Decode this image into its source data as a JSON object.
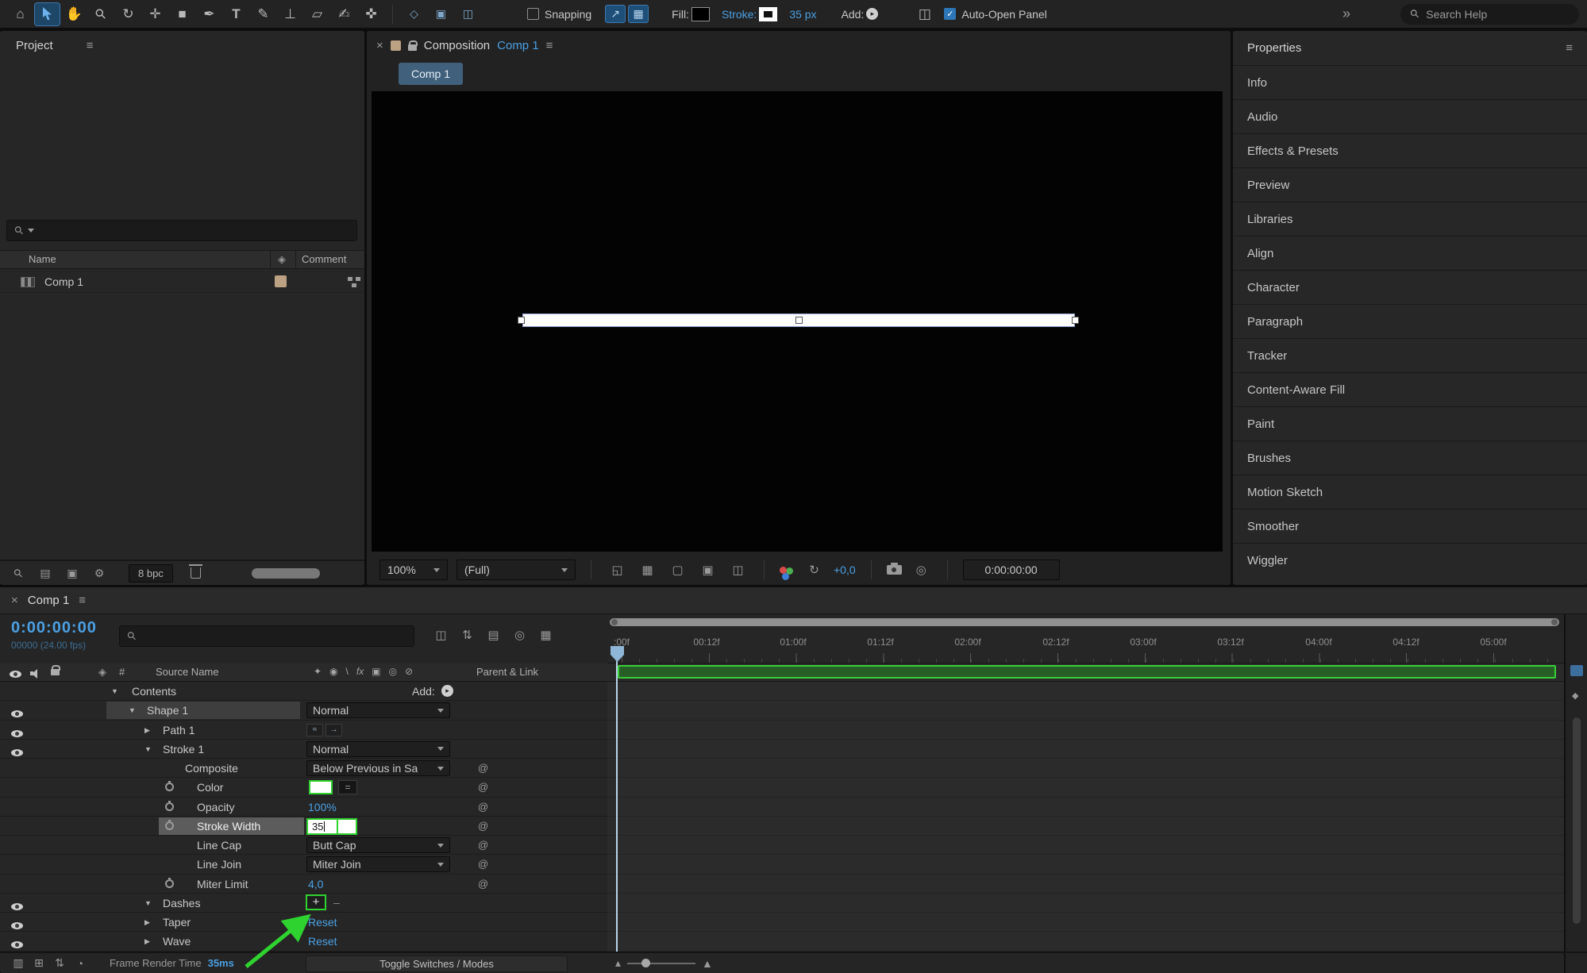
{
  "accent": {
    "blue": "#4aa0e4",
    "green": "#2fd32f"
  },
  "icons": {
    "home": "⌂",
    "hand": "✋",
    "zoom": "⚲",
    "rotate": "↻",
    "pan_behind": "✛",
    "shape": "■",
    "pen": "✒",
    "type": "T",
    "brush": "✎",
    "stamp": "⊥",
    "eraser": "▱",
    "roto_brush": "✍",
    "puppet_pin": "✜",
    "axis_local": "◇",
    "axis_world": "▣",
    "axis_view": "◫",
    "snap_edge": "↗",
    "snap_grid": "▦",
    "workspace": "◫",
    "more": "»",
    "menu": "≡",
    "close": "×",
    "twirl_open": "▼",
    "twirl_closed": "▶",
    "plus": "+",
    "dash": "‒",
    "pickwhip": "@",
    "check": "✓",
    "play": "▸",
    "comp_flow": "◫",
    "draft": "⇅",
    "shy": "▤",
    "blend": "◎",
    "graph": "▦",
    "sw_shy": "✦",
    "sw_collapse": "◉",
    "sw_draft": "\\",
    "sw_fx": "fx",
    "sw_blend": "▣",
    "sw_mblur": "◎",
    "sw_3d": "⊘",
    "label_tag": "◈",
    "eq": "=",
    "diamond": "◆",
    "find": "⚲",
    "folder": "▤",
    "newcomp": "▣",
    "gear": "⚙",
    "mini_a": "≈",
    "mini_b": "→",
    "view_a": "◱",
    "view_b": "▦",
    "view_c": "▢",
    "view_d": "▣",
    "view_e": "◫",
    "refresh": "↻",
    "tl_a": "▥",
    "tl_b": "⊞",
    "tl_c": "⇅",
    "tl_d": "◔",
    "zoom_out": "▴",
    "zoom_in": "▲"
  },
  "toolbar": {
    "snapping_label": "Snapping",
    "fill_label": "Fill:",
    "stroke_label": "Stroke:",
    "stroke_width_label": "35 px",
    "add_label": "Add:",
    "auto_open_label": "Auto-Open Panel",
    "search_placeholder": "Search Help"
  },
  "project": {
    "title": "Project",
    "col_name": "Name",
    "col_comment": "Comment",
    "item_name": "Comp 1",
    "bpc_label": "8 bpc"
  },
  "composition": {
    "tab_label": "Composition",
    "tab_comp": "Comp 1",
    "subtab": "Comp 1",
    "zoom": "100%",
    "resolution": "(Full)",
    "exposure": "+0,0",
    "timecode": "0:00:00:00"
  },
  "properties": {
    "title": "Properties",
    "items": [
      "Info",
      "Audio",
      "Effects & Presets",
      "Preview",
      "Libraries",
      "Align",
      "Character",
      "Paragraph",
      "Tracker",
      "Content-Aware Fill",
      "Paint",
      "Brushes",
      "Motion Sketch",
      "Smoother",
      "Wiggler"
    ]
  },
  "timeline": {
    "tab": "Comp 1",
    "current_time": "0:00:00:00",
    "frame_info": "00000 (24.00 fps)",
    "col_hash": "#",
    "col_source": "Source Name",
    "col_parent": "Parent & Link",
    "add_label": "Add:",
    "ruler": [
      ":00f",
      "00:12f",
      "01:00f",
      "01:12f",
      "02:00f",
      "02:12f",
      "03:00f",
      "03:12f",
      "04:00f",
      "04:12f",
      "05:00f"
    ],
    "rows": {
      "contents": "Contents",
      "shape1": "Shape 1",
      "shape1_mode": "Normal",
      "path1": "Path 1",
      "stroke1": "Stroke 1",
      "stroke1_mode": "Normal",
      "composite": "Composite",
      "composite_value": "Below Previous in Sa",
      "color": "Color",
      "opacity": "Opacity",
      "opacity_value": "100%",
      "stroke_width": "Stroke Width",
      "stroke_width_value": "35",
      "line_cap": "Line Cap",
      "line_cap_value": "Butt Cap",
      "line_join": "Line Join",
      "line_join_value": "Miter Join",
      "miter_limit": "Miter Limit",
      "miter_limit_value": "4,0",
      "dashes": "Dashes",
      "taper": "Taper",
      "taper_value": "Reset",
      "wave": "Wave",
      "wave_value": "Reset"
    },
    "status": {
      "render_label": "Frame Render Time",
      "render_value": "35ms",
      "toggle_label": "Toggle Switches / Modes"
    }
  }
}
